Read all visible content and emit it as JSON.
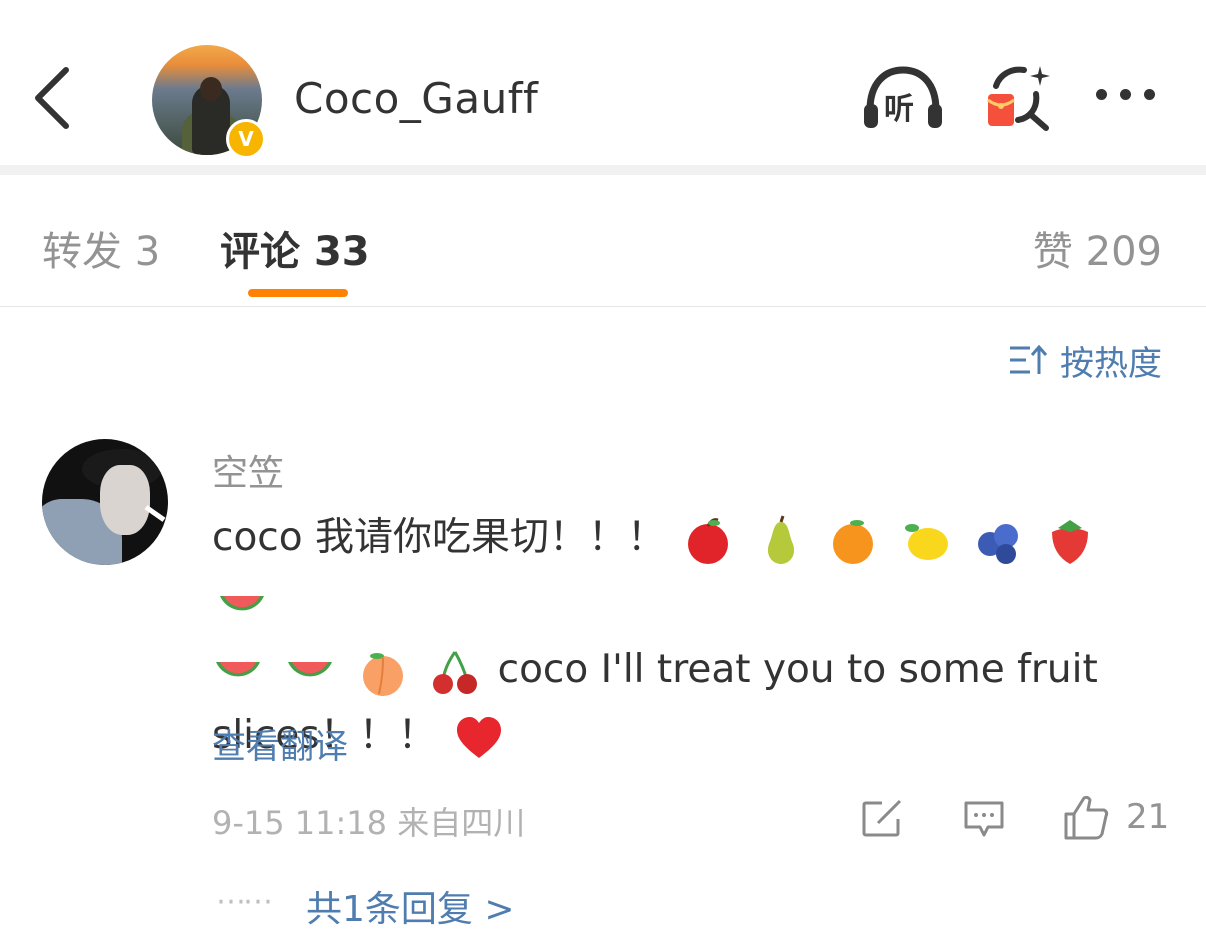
{
  "header": {
    "username": "Coco_Gauff",
    "listen_label": "听",
    "verified_badge": "V",
    "icons": {
      "back": "chevron-left-icon",
      "listen": "headphones-icon",
      "red_packet": "red-packet-search-icon",
      "more": "more-dots-icon"
    }
  },
  "tabs": [
    {
      "label": "转发",
      "count": "3"
    },
    {
      "label": "评论",
      "count": "33"
    },
    {
      "label": "赞",
      "count": "209"
    }
  ],
  "sort": {
    "label": "按热度",
    "icon": "sort-icon"
  },
  "comment": {
    "author": "空笠",
    "text_line1_prefix": "coco 我请你吃果切！！！",
    "text_suffix": "coco I'll treat you to some fruit slices！！！",
    "emojis": [
      "apple",
      "pear",
      "orange",
      "lemon",
      "blueberries",
      "strawberry",
      "watermelon",
      "watermelon",
      "watermelon",
      "peach",
      "cherries",
      "red-heart"
    ],
    "translate_label": "查看翻译",
    "meta": "9-15 11:18  来自四川",
    "like_count": "21",
    "reply_dots": "⋯⋯",
    "replies_label": "共1条回复 >"
  },
  "colors": {
    "accent_orange": "#ff8200",
    "link_blue": "#507daf",
    "muted_gray": "#939393",
    "badge_gold": "#f7b500",
    "red_packet": "#f5503b"
  }
}
